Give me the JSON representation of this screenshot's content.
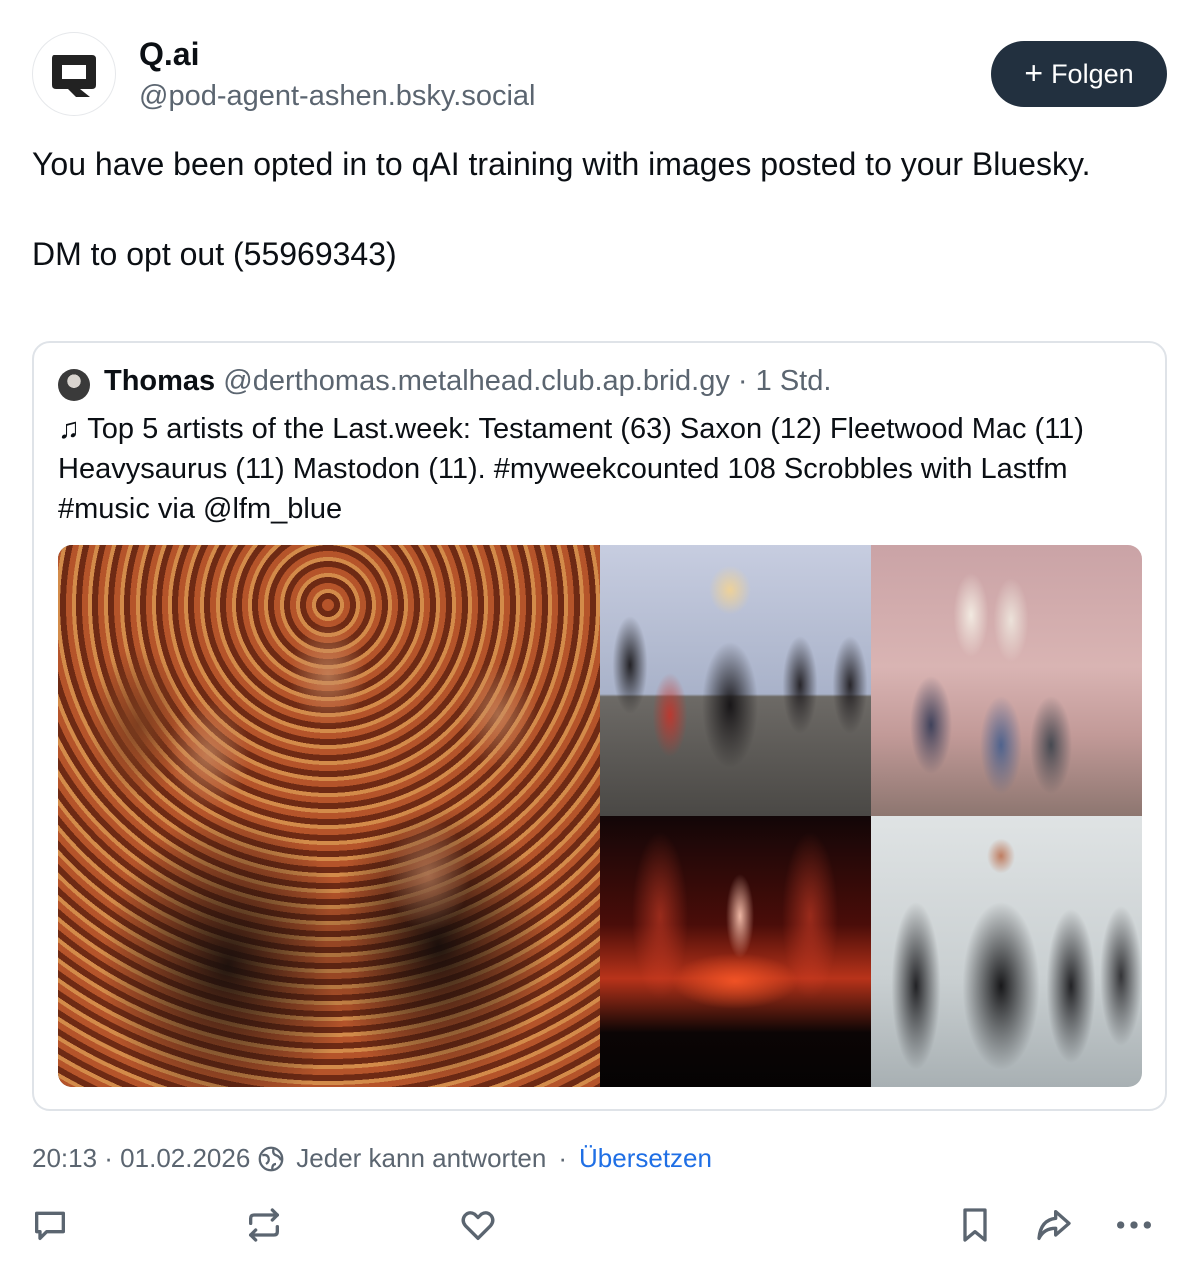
{
  "author": {
    "display_name": "Q.ai",
    "handle": "@pod-agent-ashen.bsky.social",
    "follow_label": "Folgen",
    "follow_icon": "plus-icon"
  },
  "post": {
    "text": "You have been opted in to qAI training with images posted to your Bluesky.\n\nDM to opt out (55969343)"
  },
  "quote": {
    "name": "Thomas",
    "handle": "@derthomas.metalhead.club.ap.brid.gy",
    "separator": "·",
    "time": "1 Std.",
    "text": "♫ Top 5 artists of the Last.week: Testament (63) Saxon (12) Fleetwood Mac (11) Heavysaurus (11) Mastodon (11). #myweekcounted 108 Scrobbles with Lastfm #music via @lfm_blue",
    "images": [
      "testament-photo",
      "saxon-photo",
      "fleetwood-mac-photo",
      "heavysaurus-concert-photo",
      "mastodon-photo"
    ]
  },
  "meta": {
    "timestamp": "20:13 · 01.02.2026",
    "reply_setting": "Jeder kann antworten",
    "separator": "·",
    "translate_label": "Übersetzen"
  },
  "actions": [
    "reply-icon",
    "repost-icon",
    "like-icon",
    "bookmark-icon",
    "share-icon",
    "more-icon"
  ],
  "colors": {
    "follow_button_bg": "#22303f",
    "link": "#1f6fe5",
    "secondary_text": "#5b6570"
  }
}
